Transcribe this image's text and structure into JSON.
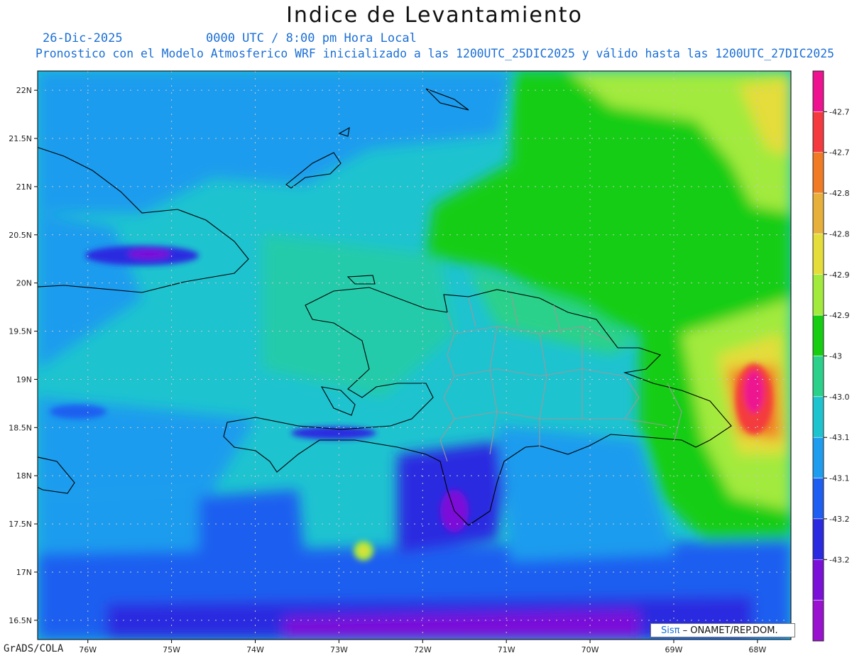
{
  "header": {
    "title": "Indice de Levantamiento",
    "date": "26-Dic-2025",
    "time": "0000 UTC / 8:00 pm Hora Local",
    "subtitle": "Pronostico con el Modelo Atmosferico WRF inicializado a las 1200UTC_25DIC2025 y válido hasta las  1200UTC_27DIC2025"
  },
  "footer": {
    "software": "GrADS/COLA",
    "credit_logo": "Sisπ",
    "credit_text": "– ONAMET/REP.DOM."
  },
  "chart_data": {
    "type": "heatmap",
    "variable": "Indice de Levantamiento",
    "lon_range": [
      -76.6,
      -67.6
    ],
    "lat_range": [
      16.3,
      22.2
    ],
    "x_ticks": [
      "76W",
      "75W",
      "74W",
      "73W",
      "72W",
      "71W",
      "70W",
      "69W",
      "68W"
    ],
    "x_tick_values": [
      -76,
      -75,
      -74,
      -73,
      -72,
      -71,
      -70,
      -69,
      -68
    ],
    "y_ticks": [
      "22N",
      "21.5N",
      "21N",
      "20.5N",
      "20N",
      "19.5N",
      "19N",
      "18.5N",
      "18N",
      "17.5N",
      "17N",
      "16.5N"
    ],
    "y_tick_values": [
      22,
      21.5,
      21,
      20.5,
      20,
      19.5,
      19,
      18.5,
      18,
      17.5,
      17,
      16.5
    ],
    "grid": true,
    "colorbar": {
      "colors": [
        "#ee1290",
        "#f43a3e",
        "#f17a25",
        "#e6b03a",
        "#e4dd3a",
        "#a2ea3c",
        "#16cd12",
        "#2bd18a",
        "#1ec3d0",
        "#1e9cee",
        "#1e5ef0",
        "#2a2ae0",
        "#7b10d9",
        "#9a12d0"
      ],
      "labels": [
        "-42.7",
        "-42.7",
        "-42.8",
        "-42.8",
        "-42.9",
        "-42.9",
        "-43",
        "-43.0",
        "-43.1",
        "-43.1",
        "-43.2",
        "-43.2"
      ]
    },
    "regions": [
      {
        "name": "green-northeast",
        "lon": [
          -71.0,
          -67.6
        ],
        "lat": [
          19.5,
          22.2
        ],
        "value": -43.0
      },
      {
        "name": "yellow-green-east",
        "lon": [
          -68.7,
          -67.6
        ],
        "lat": [
          17.6,
          19.8
        ],
        "value": -42.93
      },
      {
        "name": "magenta-storm",
        "lon": [
          -68.1,
          -67.8
        ],
        "lat": [
          18.5,
          19.1
        ],
        "value": -42.71
      },
      {
        "name": "blue-west",
        "lon": [
          -76.6,
          -73.2
        ],
        "lat": [
          17.5,
          22.2
        ],
        "value": -43.13
      },
      {
        "name": "purple-south",
        "lon": [
          -75.2,
          -68.5
        ],
        "lat": [
          16.3,
          17.0
        ],
        "value": -43.24
      }
    ]
  }
}
